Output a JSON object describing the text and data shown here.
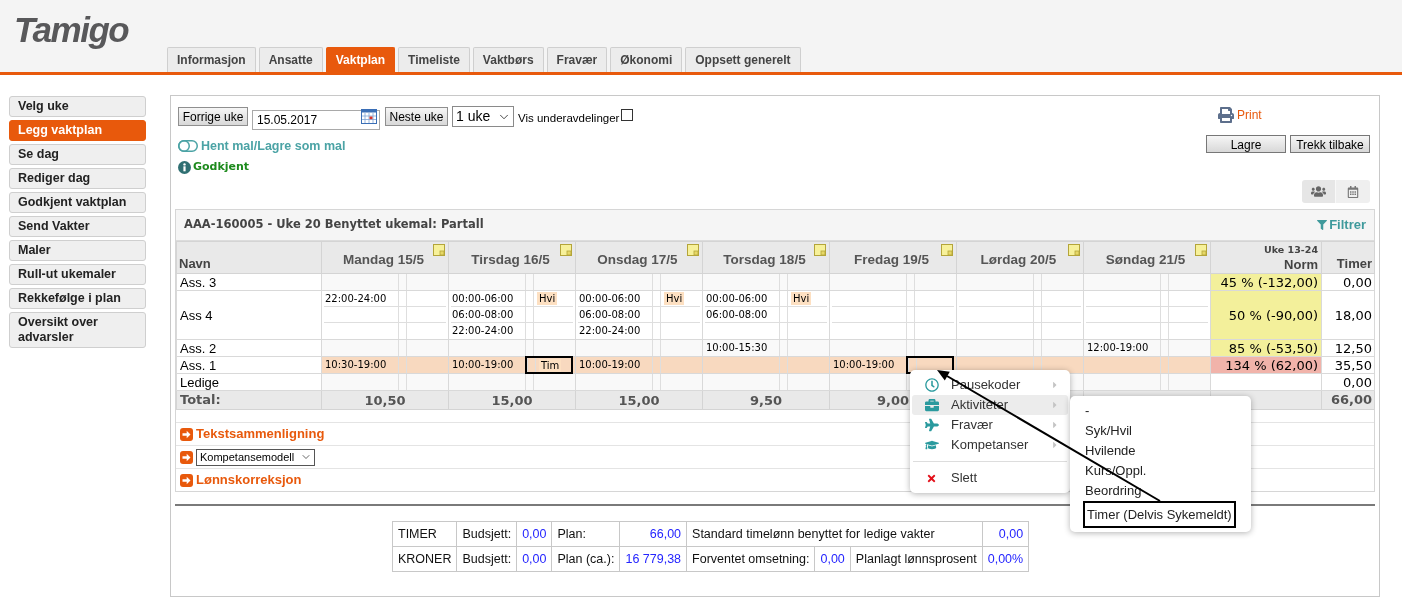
{
  "logo": {
    "text": "Tamigo"
  },
  "tabs": [
    {
      "label": "Informasjon",
      "selected": false
    },
    {
      "label": "Ansatte",
      "selected": false
    },
    {
      "label": "Vaktplan",
      "selected": true
    },
    {
      "label": "Timeliste",
      "selected": false
    },
    {
      "label": "Vaktbørs",
      "selected": false
    },
    {
      "label": "Fravær",
      "selected": false
    },
    {
      "label": "Økonomi",
      "selected": false
    },
    {
      "label": "Oppsett generelt",
      "selected": false
    }
  ],
  "sidebar": {
    "items": [
      {
        "label": "Velg uke",
        "selected": false
      },
      {
        "label": "Legg vaktplan",
        "selected": true
      },
      {
        "label": "Se dag",
        "selected": false
      },
      {
        "label": "Rediger dag",
        "selected": false
      },
      {
        "label": "Godkjent vaktplan",
        "selected": false
      },
      {
        "label": "Send Vakter",
        "selected": false
      },
      {
        "label": "Maler",
        "selected": false
      },
      {
        "label": "Rull-ut ukemaler",
        "selected": false
      },
      {
        "label": "Rekkefølge i plan",
        "selected": false
      },
      {
        "label": "Oversikt over advarsler",
        "selected": false
      }
    ]
  },
  "toolbar": {
    "previous_button": "Forrige uke",
    "date_field": {
      "value": "15.05.2017"
    },
    "next_button": "Neste uke",
    "period_select": {
      "value": "1 uke"
    },
    "subdivisions": {
      "label": "Vis underavdelinger",
      "checked": false
    }
  },
  "template_link": "Hent mal/Lagre som mal",
  "approval_status": "Godkjent",
  "print_link": "Print",
  "action_buttons": [
    "Lagre",
    "Trekk tilbake"
  ],
  "schedule": {
    "title": "AAA-160005 - Uke 20 Benyttet ukemal: Partall",
    "filter_link": "Filtrer",
    "columns": {
      "name": "Navn",
      "days": [
        "Mandag 15/5",
        "Tirsdag 16/5",
        "Onsdag 17/5",
        "Torsdag 18/5",
        "Fredag 19/5",
        "Lørdag 20/5",
        "Søndag 21/5"
      ],
      "norm_period": "Uke 13-24",
      "norm": "Norm",
      "hours": "Timer"
    },
    "rows": [
      {
        "name": "Ass. 3",
        "selected": false,
        "days": [
          {
            "kind": "empty"
          },
          {
            "kind": "empty"
          },
          {
            "kind": "empty"
          },
          {
            "kind": "empty"
          },
          {
            "kind": "empty"
          },
          {
            "kind": "empty"
          },
          {
            "kind": "empty"
          }
        ],
        "norm": {
          "text": "45 % (-132,00)",
          "color": "#f3f09b"
        },
        "hours": "0,00"
      },
      {
        "name": "Ass 4",
        "selected": false,
        "days": [
          {
            "kind": "shifts",
            "lines": [
              {
                "time": "22:00-24:00",
                "outlined": false
              }
            ]
          },
          {
            "kind": "shifts",
            "lines": [
              {
                "time": "00:00-06:00",
                "code": "Hvi",
                "outlined": false
              },
              {
                "time": "06:00-08:00",
                "outlined": false
              },
              {
                "time": "22:00-24:00",
                "outlined": false
              }
            ]
          },
          {
            "kind": "shifts",
            "lines": [
              {
                "time": "00:00-06:00",
                "code": "Hvi",
                "outlined": false
              },
              {
                "time": "06:00-08:00",
                "outlined": false
              },
              {
                "time": "22:00-24:00",
                "outlined": false
              }
            ]
          },
          {
            "kind": "shifts",
            "lines": [
              {
                "time": "00:00-06:00",
                "code": "Hvi",
                "outlined": false
              },
              {
                "time": "06:00-08:00",
                "outlined": false
              }
            ]
          },
          {
            "kind": "empty"
          },
          {
            "kind": "empty"
          },
          {
            "kind": "empty"
          }
        ],
        "norm": {
          "text": "50 % (-90,00)",
          "color": "#f3f09b"
        },
        "hours": "18,00"
      },
      {
        "name": "Ass. 2",
        "selected": false,
        "days": [
          {
            "kind": "empty"
          },
          {
            "kind": "empty"
          },
          {
            "kind": "empty"
          },
          {
            "kind": "shifts",
            "lines": [
              {
                "time": "10:00-15:30",
                "outlined": false
              }
            ]
          },
          {
            "kind": "empty"
          },
          {
            "kind": "empty"
          },
          {
            "kind": "shifts",
            "lines": [
              {
                "time": "12:00-19:00",
                "outlined": false
              }
            ]
          }
        ],
        "norm": {
          "text": "85 % (-53,50)",
          "color": "#f3f09b"
        },
        "hours": "12,50"
      },
      {
        "name": "Ass. 1",
        "selected": true,
        "days": [
          {
            "kind": "shifts",
            "lines": [
              {
                "time": "10:30-19:00",
                "outlined": false
              }
            ]
          },
          {
            "kind": "shifts",
            "lines": [
              {
                "time": "10:00-19:00",
                "code": "Tim",
                "outlined": true
              }
            ]
          },
          {
            "kind": "shifts",
            "lines": [
              {
                "time": "10:00-19:00",
                "outlined": false
              }
            ]
          },
          {
            "kind": "empty"
          },
          {
            "kind": "shifts",
            "lines": [
              {
                "time": "10:00-19:00",
                "outlined": true
              }
            ]
          },
          {
            "kind": "empty"
          },
          {
            "kind": "empty"
          }
        ],
        "norm": {
          "text": "134 % (62,00)",
          "color": "#f1b3aa"
        },
        "hours": "35,50"
      },
      {
        "name": "Ledige",
        "selected": false,
        "days": [
          {
            "kind": "empty"
          },
          {
            "kind": "empty"
          },
          {
            "kind": "empty"
          },
          {
            "kind": "empty"
          },
          {
            "kind": "empty"
          },
          {
            "kind": "empty"
          },
          {
            "kind": "empty"
          }
        ],
        "hours": "0,00"
      }
    ],
    "totals": {
      "label": "Total:",
      "days": [
        "10,50",
        "15,00",
        "15,00",
        "9,50",
        "9,00"
      ],
      "hours": "66,00"
    }
  },
  "sections": [
    {
      "kind": "link",
      "label": "Tekstsammenligning"
    },
    {
      "kind": "select",
      "value": "Kompetansemodell"
    },
    {
      "kind": "link",
      "label": "Lønnskorreksjon"
    }
  ],
  "summary": {
    "rows": [
      {
        "cells": [
          {
            "kind": "label",
            "text": "TIMER"
          },
          {
            "kind": "label",
            "text": "Budsjett:"
          },
          {
            "kind": "value",
            "text": "0,00"
          },
          {
            "kind": "label",
            "text": "Plan:"
          },
          {
            "kind": "value",
            "text": "66,00"
          },
          {
            "kind": "label",
            "text": "Standard timelønn benyttet for ledige vakter",
            "colspan": 3
          },
          {
            "kind": "value",
            "text": "0,00"
          }
        ]
      },
      {
        "cells": [
          {
            "kind": "label",
            "text": "KRONER"
          },
          {
            "kind": "label",
            "text": "Budsjett:"
          },
          {
            "kind": "value",
            "text": "0,00"
          },
          {
            "kind": "label",
            "text": "Plan (ca.):"
          },
          {
            "kind": "value",
            "text": "16 779,38"
          },
          {
            "kind": "label",
            "text": "Forventet omsetning:"
          },
          {
            "kind": "value",
            "text": "0,00"
          },
          {
            "kind": "label",
            "text": "Planlagt lønnsprosent"
          },
          {
            "kind": "value",
            "text": "0,00%"
          }
        ]
      }
    ]
  },
  "context_menu": {
    "items": [
      {
        "kind": "submenu",
        "label": "Pausekoder",
        "selected": false
      },
      {
        "kind": "submenu",
        "label": "Aktiviteter",
        "selected": true
      },
      {
        "kind": "submenu",
        "label": "Fravær",
        "selected": false
      },
      {
        "kind": "submenu",
        "label": "Kompetanser",
        "selected": false
      },
      {
        "kind": "action",
        "label": "Slett",
        "selected": false
      }
    ]
  },
  "activities_submenu": {
    "items": [
      {
        "label": "-",
        "outlined": false
      },
      {
        "label": "Syk/Hvil",
        "outlined": false
      },
      {
        "label": "Hvilende",
        "outlined": false
      },
      {
        "label": "Kurs/Oppl.",
        "outlined": false
      },
      {
        "label": "Beordring",
        "outlined": false
      },
      {
        "label": "Timer (Delvis Sykemeldt)",
        "outlined": true
      }
    ]
  }
}
